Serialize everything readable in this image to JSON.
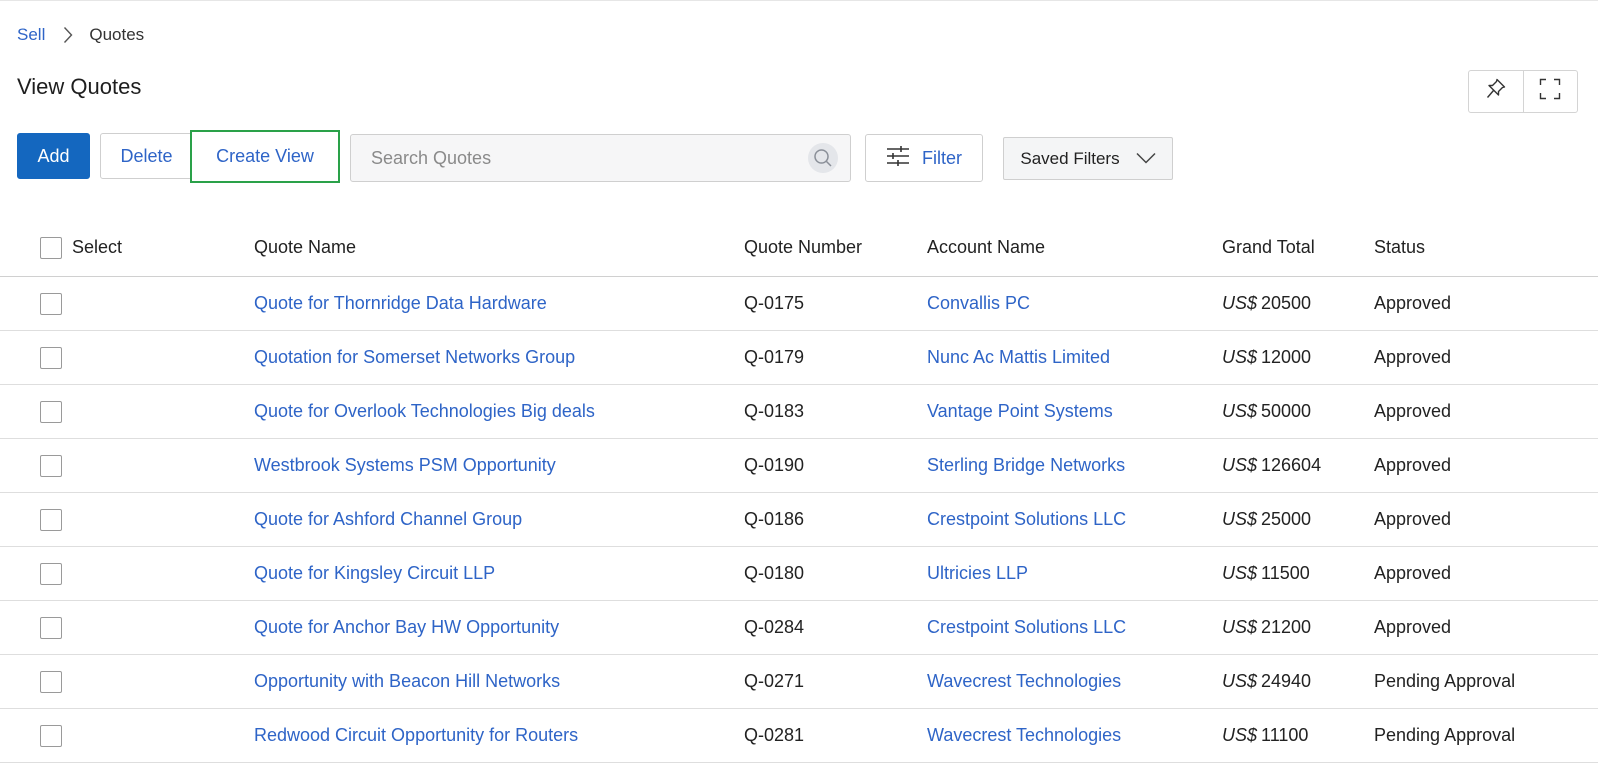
{
  "breadcrumb": {
    "parent": "Sell",
    "current": "Quotes"
  },
  "page": {
    "title": "View Quotes"
  },
  "toolbar": {
    "add_label": "Add",
    "delete_label": "Delete",
    "create_view_label": "Create View",
    "search_placeholder": "Search Quotes",
    "filter_label": "Filter",
    "saved_filters_label": "Saved Filters"
  },
  "icons": {
    "pin": "pin-icon",
    "expand": "fullscreen-icon",
    "search": "search-icon",
    "filter": "sliders-icon",
    "dropdown": "chevron-down-icon",
    "breadcrumb_separator": "chevron-right-icon"
  },
  "colors": {
    "primary": "#1467bf",
    "link": "#2e64c7",
    "highlight_border": "#2aa149"
  },
  "table": {
    "columns": {
      "select": "Select",
      "quote_name": "Quote Name",
      "quote_number": "Quote Number",
      "account_name": "Account Name",
      "grand_total": "Grand Total",
      "status": "Status"
    },
    "rows": [
      {
        "quote_name": "Quote for Thornridge Data Hardware",
        "quote_number": "Q-0175",
        "account_name": "Convallis PC",
        "currency": "US$",
        "grand_total": "20500",
        "status": "Approved"
      },
      {
        "quote_name": "Quotation for Somerset Networks Group",
        "quote_number": "Q-0179",
        "account_name": "Nunc Ac Mattis Limited",
        "currency": "US$",
        "grand_total": "12000",
        "status": "Approved"
      },
      {
        "quote_name": "Quote for Overlook Technologies Big deals",
        "quote_number": "Q-0183",
        "account_name": "Vantage Point Systems",
        "currency": "US$",
        "grand_total": "50000",
        "status": "Approved"
      },
      {
        "quote_name": "Westbrook Systems PSM Opportunity",
        "quote_number": "Q-0190",
        "account_name": "Sterling Bridge Networks",
        "currency": "US$",
        "grand_total": "126604",
        "status": "Approved"
      },
      {
        "quote_name": "Quote for Ashford Channel Group",
        "quote_number": "Q-0186",
        "account_name": "Crestpoint Solutions LLC",
        "currency": "US$",
        "grand_total": "25000",
        "status": "Approved"
      },
      {
        "quote_name": "Quote for Kingsley Circuit LLP",
        "quote_number": "Q-0180",
        "account_name": "Ultricies LLP",
        "currency": "US$",
        "grand_total": "11500",
        "status": "Approved"
      },
      {
        "quote_name": "Quote for Anchor Bay HW Opportunity",
        "quote_number": "Q-0284",
        "account_name": "Crestpoint Solutions LLC",
        "currency": "US$",
        "grand_total": "21200",
        "status": "Approved"
      },
      {
        "quote_name": "Opportunity with Beacon Hill Networks",
        "quote_number": "Q-0271",
        "account_name": "Wavecrest Technologies",
        "currency": "US$",
        "grand_total": "24940",
        "status": "Pending Approval"
      },
      {
        "quote_name": "Redwood Circuit Opportunity for Routers",
        "quote_number": "Q-0281",
        "account_name": "Wavecrest Technologies",
        "currency": "US$",
        "grand_total": "11100",
        "status": "Pending Approval"
      }
    ]
  }
}
